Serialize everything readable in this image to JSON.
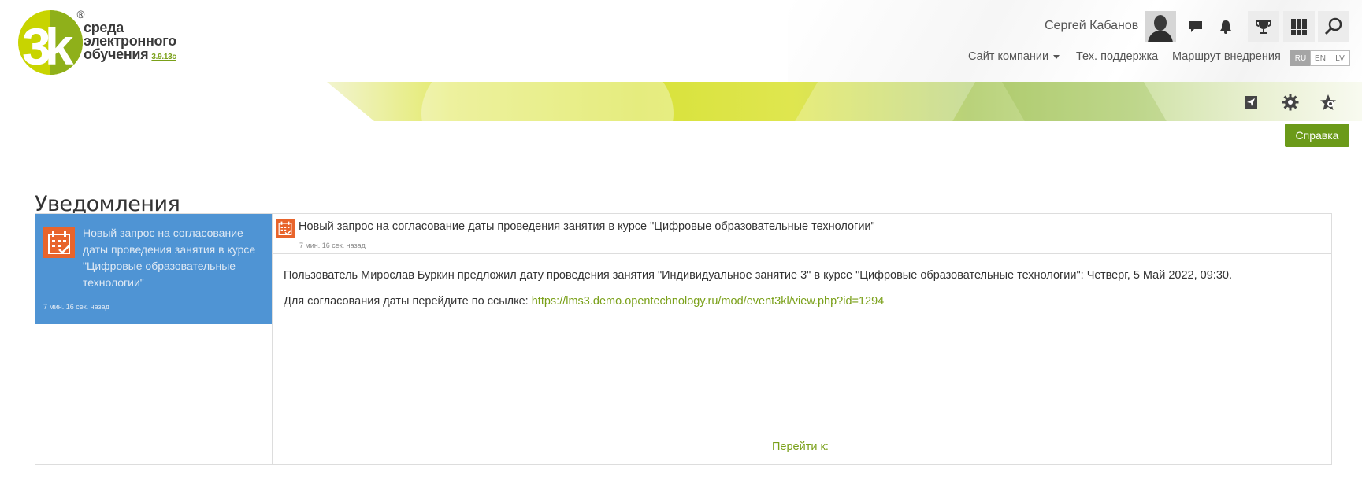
{
  "logo": {
    "mark_text": "3k",
    "registered": "®",
    "line1": "среда",
    "line2": "электронного",
    "line3": "обучения",
    "version": "3.9.13c"
  },
  "header": {
    "user_name": "Сергей Кабанов",
    "icons": [
      "messages-icon",
      "bell-icon",
      "trophy-icon",
      "apps-grid-icon",
      "search-icon"
    ],
    "nav": {
      "company_site": "Сайт компании",
      "support": "Тех. поддержка",
      "route": "Маршрут внедрения"
    },
    "languages": [
      "RU",
      "EN",
      "LV"
    ],
    "active_language": "RU"
  },
  "toolbar": {
    "icons": [
      "send-icon",
      "gear-icon",
      "star-admin-icon"
    ],
    "help_label": "Справка"
  },
  "page": {
    "title": "Уведомления"
  },
  "notifications": {
    "list": [
      {
        "title": "Новый запрос на согласование даты проведения занятия в курсе \"Цифровые образовательные технологии\"",
        "time": "7 мин. 16 сек. назад"
      }
    ],
    "selected": {
      "title": "Новый запрос на согласование даты проведения занятия в курсе \"Цифровые образовательные технологии\"",
      "time": "7 мин. 16 сек. назад",
      "body_line1": "Пользователь Мирослав Буркин предложил дату проведения занятия \"Индивидуальное занятие 3\" в курсе \"Цифровые образовательные технологии\": Четверг, 5 Май 2022, 09:30.",
      "body_line2_prefix": "Для согласования даты перейдите по ссылке: ",
      "link": "https://lms3.demo.opentechnology.ru/mod/event3kl/view.php?id=1294",
      "goto_label": "Перейти к:"
    }
  },
  "colors": {
    "accent_green": "#6b9a19",
    "link_green": "#7aa019",
    "selected_blue": "#4f94d4",
    "event_icon_orange": "#e8642c"
  }
}
